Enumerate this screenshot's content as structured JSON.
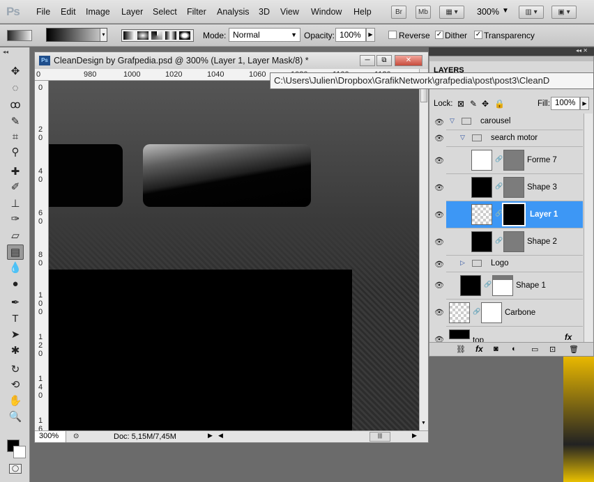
{
  "app": {
    "logo": "Ps"
  },
  "menu": [
    "File",
    "Edit",
    "Image",
    "Layer",
    "Select",
    "Filter",
    "Analysis",
    "3D",
    "View",
    "Window",
    "Help"
  ],
  "menubar_extras": {
    "br": "Br",
    "mb": "Mb",
    "zoom": "300%"
  },
  "options": {
    "mode_label": "Mode:",
    "mode_value": "Normal",
    "opacity_label": "Opacity:",
    "opacity_value": "100%",
    "reverse_label": "Reverse",
    "reverse_checked": false,
    "dither_label": "Dither",
    "dither_checked": true,
    "transparency_label": "Transparency",
    "transparency_checked": true
  },
  "document": {
    "title": "CleanDesign by Grafpedia.psd @ 300% (Layer 1, Layer Mask/8) *",
    "ruler_top": [
      "0",
      "980",
      "1000",
      "1020",
      "1040",
      "1060",
      "1080",
      "1100",
      "1120"
    ],
    "ruler_left": [
      "0",
      "2 0",
      "4 0",
      "6 0",
      "8 0",
      "1 0 0",
      "1 2 0",
      "1 4 0",
      "1 6 0"
    ],
    "zoom": "300%",
    "doc_size": "Doc: 5,15M/7,45M"
  },
  "tooltip": "C:\\Users\\Julien\\Dropbox\\GrafikNetwork\\grafpedia\\post\\post3\\CleanD",
  "layers": {
    "tab": "LAYERS",
    "lock_label": "Lock:",
    "fill_label": "Fill:",
    "fill_value": "100%",
    "rows": [
      {
        "name": "carousel",
        "kind": "group"
      },
      {
        "name": "search motor",
        "kind": "group"
      },
      {
        "name": "Forme 7",
        "kind": "layer"
      },
      {
        "name": "Shape 3",
        "kind": "layer"
      },
      {
        "name": "Layer 1",
        "kind": "layer",
        "selected": true
      },
      {
        "name": "Shape 2",
        "kind": "layer"
      },
      {
        "name": "Logo",
        "kind": "group"
      },
      {
        "name": "Shape 1",
        "kind": "layer"
      },
      {
        "name": "Carbone",
        "kind": "layer"
      },
      {
        "name": "top",
        "kind": "layer"
      }
    ],
    "footer_fx": "fx"
  },
  "colors": {
    "selected_row": "#3d97f5"
  }
}
